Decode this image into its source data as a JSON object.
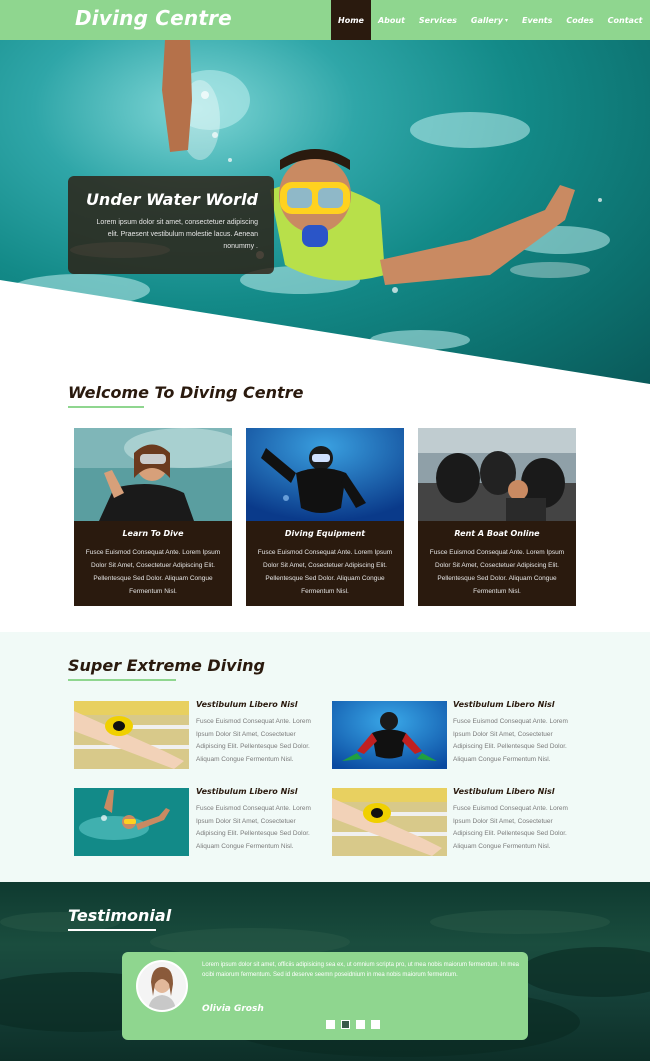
{
  "header": {
    "logo": "Diving Centre",
    "nav": [
      {
        "label": "Home",
        "active": true
      },
      {
        "label": "About",
        "active": false
      },
      {
        "label": "Services",
        "active": false
      },
      {
        "label": "Gallery",
        "active": false,
        "dropdown": true
      },
      {
        "label": "Events",
        "active": false
      },
      {
        "label": "Codes",
        "active": false
      },
      {
        "label": "Contact",
        "active": false
      }
    ]
  },
  "hero": {
    "title": "Under Water World",
    "text": "Lorem ipsum dolor sit amet, consectetuer adipiscing elit. Praesent vestibulum molestie lacus. Aenean nonummy ."
  },
  "welcome": {
    "title": "Welcome To Diving Centre",
    "cards": [
      {
        "title": "Learn To Dive",
        "text": "Fusce Euismod Consequat Ante. Lorem Ipsum Dolor Sit Amet, Cosectetuer Adipiscing Elit. Pellentesque Sed Dolor. Aliquam Congue Fermentum Nisl."
      },
      {
        "title": "Diving Equipment",
        "text": "Fusce Euismod Consequat Ante. Lorem Ipsum Dolor Sit Amet, Cosectetuer Adipiscing Elit. Pellentesque Sed Dolor. Aliquam Congue Fermentum Nisl."
      },
      {
        "title": "Rent A Boat Online",
        "text": "Fusce Euismod Consequat Ante. Lorem Ipsum Dolor Sit Amet, Cosectetuer Adipiscing Elit. Pellentesque Sed Dolor. Aliquam Congue Fermentum Nisl."
      }
    ]
  },
  "extreme": {
    "title": "Super Extreme Diving",
    "items": [
      {
        "title": "Vestibulum Libero Nisl",
        "text": "Fusce Euismod Consequat Ante. Lorem Ipsum Dolor Sit Amet, Cosectetuer Adipiscing Elit. Pellentesque Sed Dolor. Aliquam Congue Fermentum Nisl."
      },
      {
        "title": "Vestibulum Libero Nisl",
        "text": "Fusce Euismod Consequat Ante. Lorem Ipsum Dolor Sit Amet, Cosectetuer Adipiscing Elit. Pellentesque Sed Dolor. Aliquam Congue Fermentum Nisl."
      },
      {
        "title": "Vestibulum Libero Nisl",
        "text": "Fusce Euismod Consequat Ante. Lorem Ipsum Dolor Sit Amet, Cosectetuer Adipiscing Elit. Pellentesque Sed Dolor. Aliquam Congue Fermentum Nisl."
      },
      {
        "title": "Vestibulum Libero Nisl",
        "text": "Fusce Euismod Consequat Ante. Lorem Ipsum Dolor Sit Amet, Cosectetuer Adipiscing Elit. Pellentesque Sed Dolor. Aliquam Congue Fermentum Nisl."
      }
    ]
  },
  "testimonial": {
    "title": "Testimonial",
    "text": "Lorem ipsum dolor sit amet, officiis adipisicing sea ex, ut omnium scripta pro, ut mea nobis maiorum fermentum. In mea ocibi maiorum fermentum. Sed id deserve seemn poseidnium in mea nobis maiorum fermentum.",
    "name": "Olivia Grosh",
    "slides": 4,
    "active_slide": 2
  },
  "colors": {
    "accent": "#8fd68f",
    "dark": "#2a1a0e"
  }
}
